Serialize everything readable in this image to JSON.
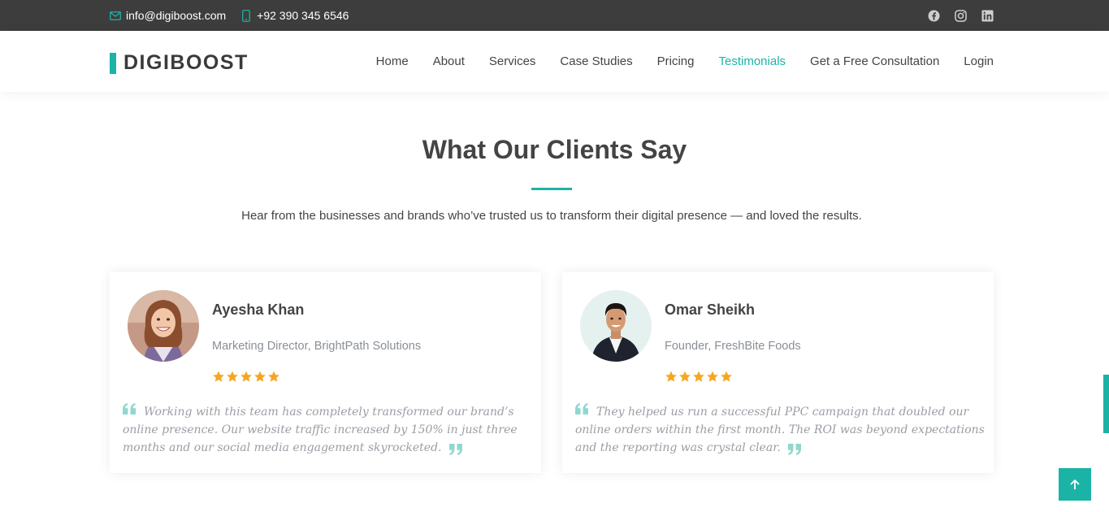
{
  "topbar": {
    "email": "info@digiboost.com",
    "phone": "+92 390 345 6546",
    "social_icons": [
      "facebook-icon",
      "instagram-icon",
      "linkedin-icon"
    ]
  },
  "brand": {
    "name": "DIGIBOOST",
    "accent_color": "#1bb3a6"
  },
  "nav": {
    "items": [
      {
        "label": "Home"
      },
      {
        "label": "About"
      },
      {
        "label": "Services"
      },
      {
        "label": "Case Studies"
      },
      {
        "label": "Pricing"
      },
      {
        "label": "Testimonials",
        "active": true
      },
      {
        "label": "Get a Free Consultation"
      },
      {
        "label": "Login"
      }
    ]
  },
  "section": {
    "title": "What Our Clients Say",
    "subtitle": "Hear from the businesses and brands who’ve trusted us to transform their digital presence — and loved the results."
  },
  "testimonials": [
    {
      "name": "Ayesha Khan",
      "role": "Marketing Director, BrightPath Solutions",
      "rating": 5,
      "quote": "Working with this team has completely transformed our brand’s online presence. Our website traffic increased by 150% in just three months and our social media engagement skyrocketed."
    },
    {
      "name": "Omar Sheikh",
      "role": "Founder, FreshBite Foods",
      "rating": 5,
      "quote": "They helped us run a successful PPC campaign that doubled our online orders within the first month. The ROI was beyond expectations and the reporting was crystal clear."
    }
  ],
  "colors": {
    "topbar_bg": "#3d3d3d",
    "accent": "#1bb3a6",
    "star": "#f5a623"
  },
  "back_to_top_icon": "arrow-up-icon"
}
